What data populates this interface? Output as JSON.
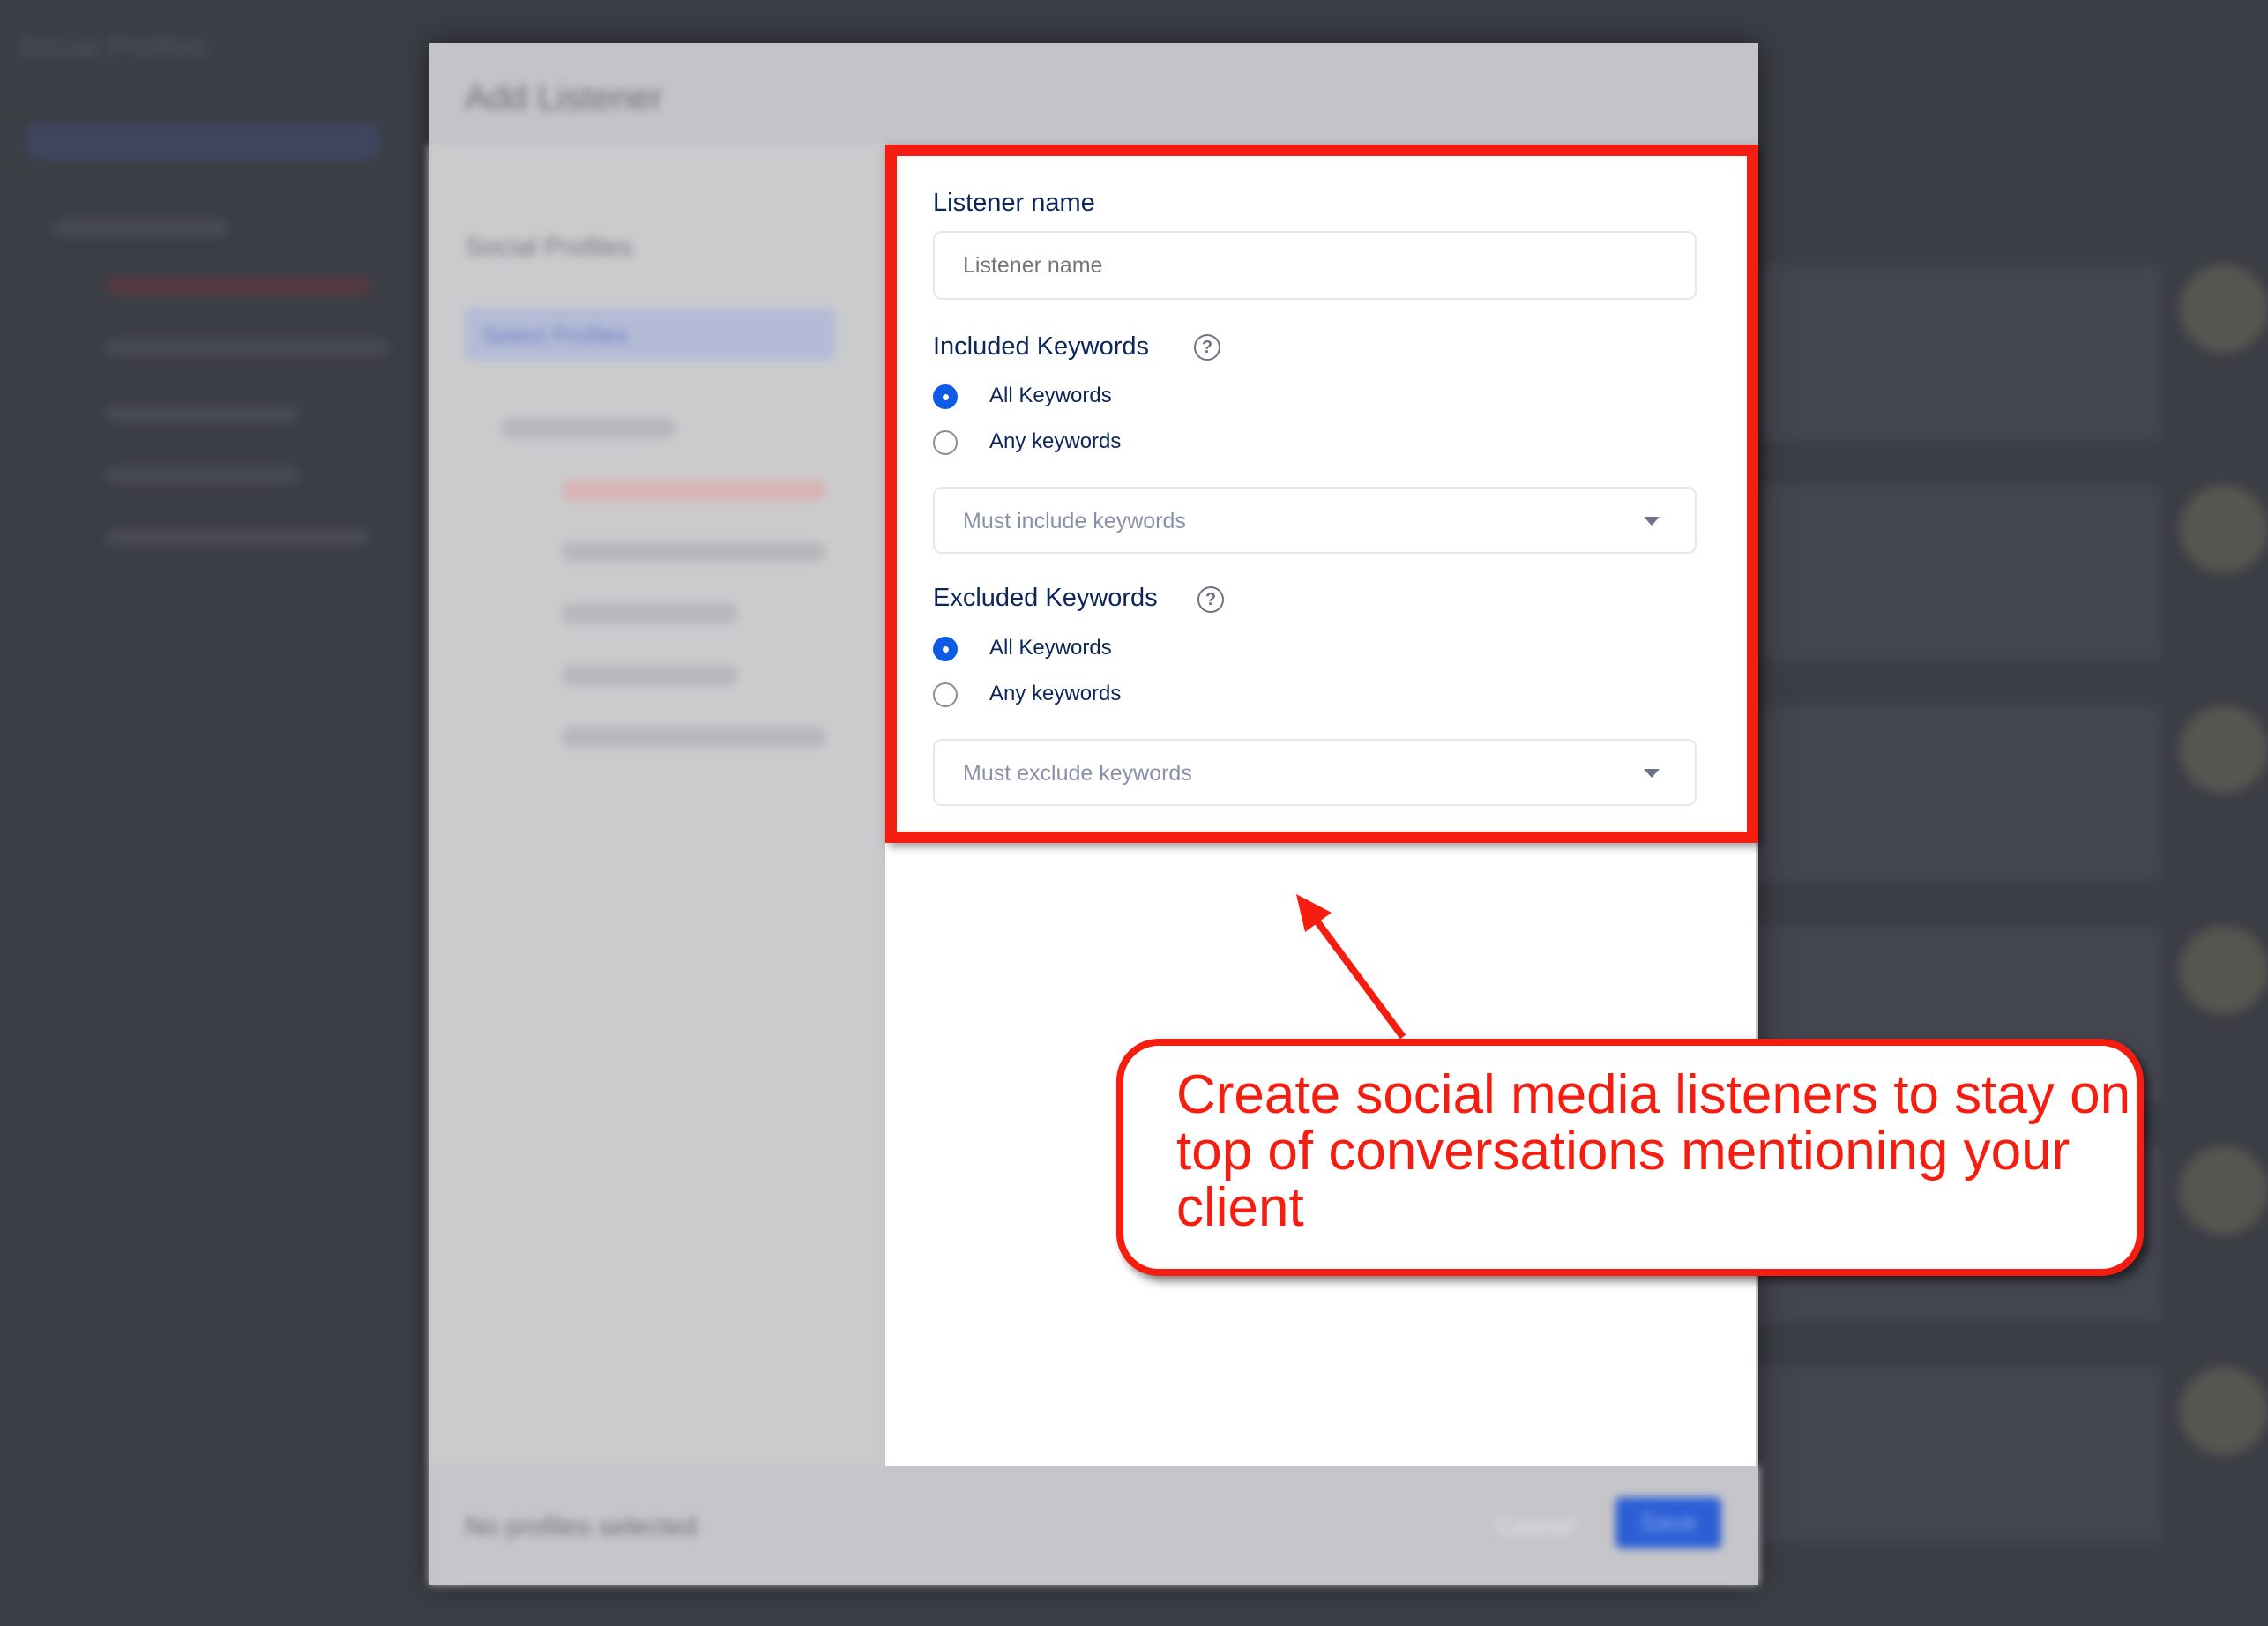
{
  "background": {
    "title": "Social Profiles"
  },
  "modal": {
    "title": "Add Listener",
    "left_panel": {
      "title": "Social Profiles",
      "select_label": "Select Profiles"
    },
    "footer": {
      "status": "No profiles selected",
      "cancel_label": "Cancel",
      "save_label": "Save"
    }
  },
  "form": {
    "listener_name": {
      "label": "Listener name",
      "placeholder": "Listener name",
      "value": ""
    },
    "included": {
      "label": "Included Keywords",
      "help_icon": "question-circle-icon",
      "options": [
        "All Keywords",
        "Any keywords"
      ],
      "selected": "All Keywords",
      "dropdown_placeholder": "Must include keywords"
    },
    "excluded": {
      "label": "Excluded Keywords",
      "help_icon": "question-circle-icon",
      "options": [
        "All Keywords",
        "Any keywords"
      ],
      "selected": "All Keywords",
      "dropdown_placeholder": "Must exclude keywords"
    }
  },
  "annotation": {
    "text": "Create social media listeners to stay on top of conversations mentioning your client",
    "color": "#f41d10"
  },
  "colors": {
    "accent": "#0e5ce6",
    "label": "#0c2659"
  }
}
